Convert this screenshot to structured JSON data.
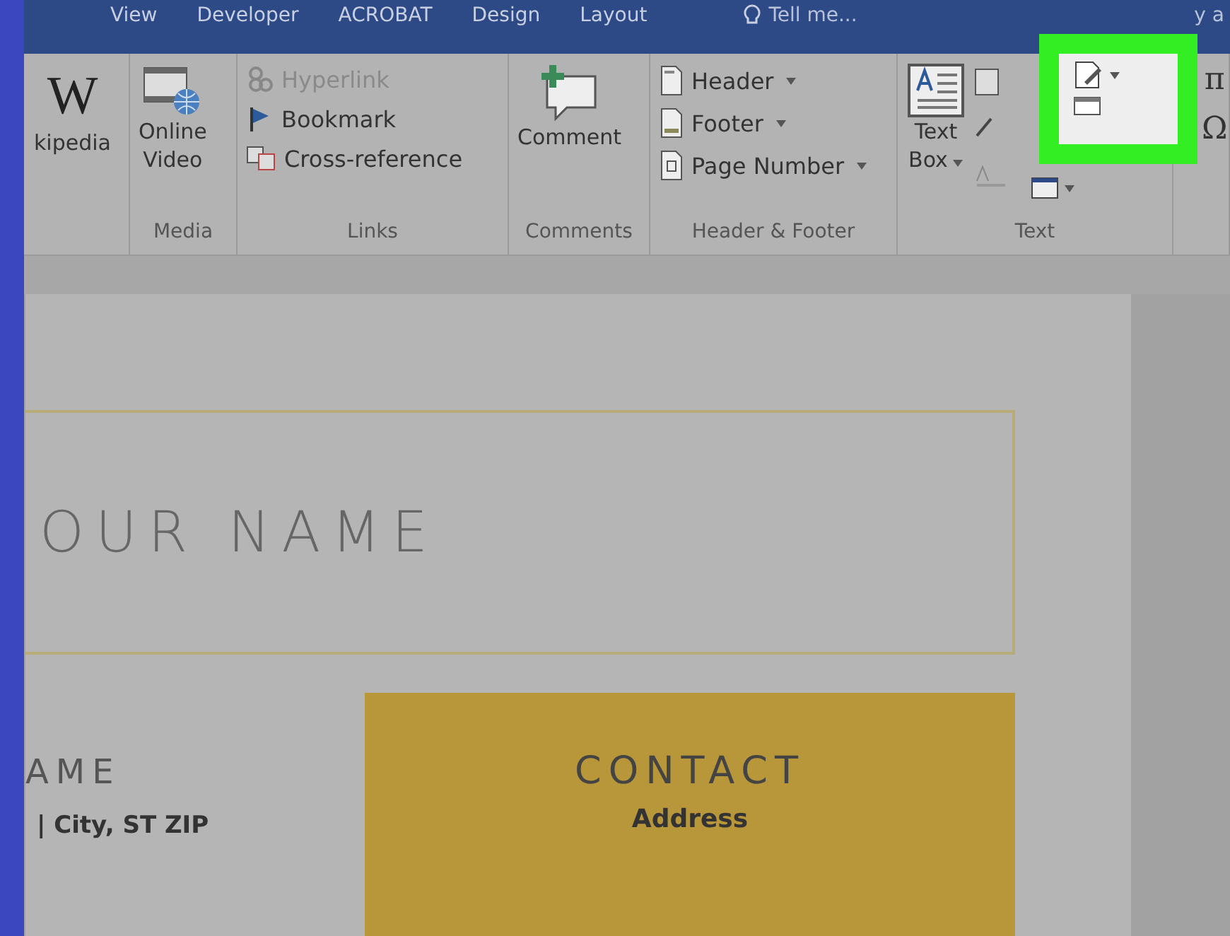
{
  "tabs": [
    {
      "label": "View",
      "selected": false
    },
    {
      "label": "Developer",
      "selected": false
    },
    {
      "label": "ACROBAT",
      "selected": false
    },
    {
      "label": "Design",
      "selected": false
    },
    {
      "label": "Layout",
      "selected": false
    }
  ],
  "tell_me": "Tell me...",
  "tab_cut": "y a",
  "ribbon": {
    "groups": [
      {
        "kind": "large",
        "items": [
          {
            "kind": "wikipedia",
            "glyph": "W",
            "label": "kipedia"
          }
        ]
      },
      {
        "label": "Media",
        "kind": "large",
        "items": [
          {
            "kind": "video",
            "label": "Online\nVideo"
          }
        ]
      },
      {
        "label": "Links",
        "kind": "list",
        "items": [
          {
            "kind": "hyperlink",
            "label": "Hyperlink",
            "disabled": true,
            "dropdown": false
          },
          {
            "kind": "bookmark",
            "label": "Bookmark",
            "disabled": false,
            "dropdown": false
          },
          {
            "kind": "crossref",
            "label": "Cross-reference",
            "disabled": false,
            "dropdown": false
          }
        ]
      },
      {
        "label": "Comments",
        "kind": "large",
        "items": [
          {
            "kind": "comment",
            "label": "Comment"
          }
        ]
      },
      {
        "label": "Header & Footer",
        "kind": "list",
        "items": [
          {
            "kind": "header",
            "label": "Header",
            "disabled": false,
            "dropdown": true
          },
          {
            "kind": "footer",
            "label": "Footer",
            "disabled": false,
            "dropdown": true
          },
          {
            "kind": "pagenumber",
            "label": "Page Number",
            "disabled": false,
            "dropdown": true
          }
        ]
      },
      {
        "label": "Text",
        "kind": "text",
        "items": [
          {
            "kind": "textbox",
            "label": "Text\nBox",
            "dropdown": true
          }
        ]
      },
      {
        "kind": "symbols",
        "items": [
          {
            "kind": "symbol",
            "glyph": "π"
          },
          {
            "kind": "symbol",
            "glyph": "Ω"
          }
        ]
      }
    ]
  },
  "document": {
    "title": "OUR NAME",
    "subtitle": "AME",
    "address_line": "| City, ST ZIP",
    "contact_heading": "CONTACT",
    "contact_line": "Address"
  }
}
